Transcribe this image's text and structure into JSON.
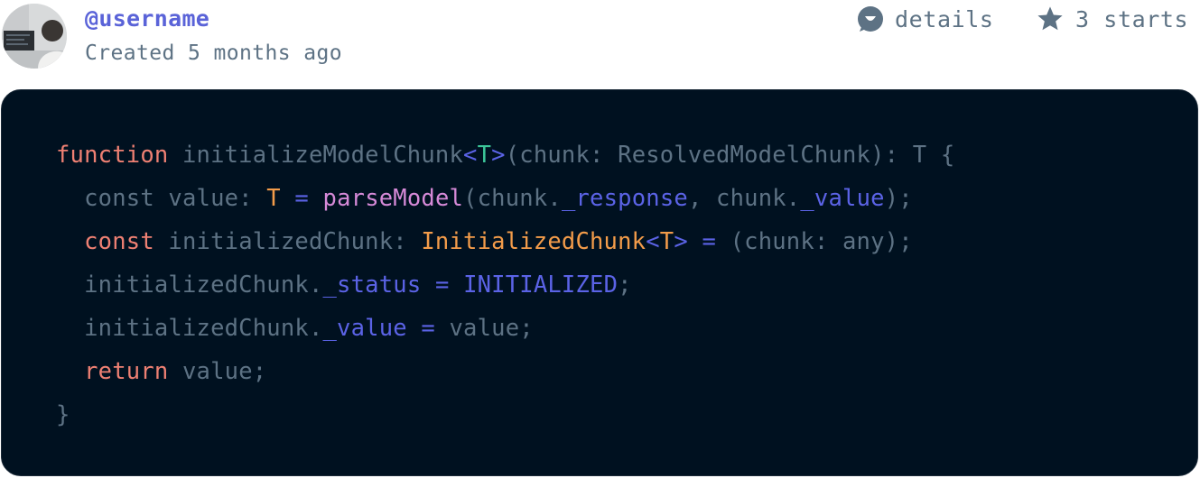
{
  "header": {
    "username": "@username",
    "created": "Created 5 months ago",
    "details_label": "details",
    "stars_label": "3 starts",
    "details_icon": "comment-bubble-icon",
    "stars_icon": "star-icon"
  },
  "colors": {
    "username": "#5a63d8",
    "muted": "#5d7284",
    "code_bg": "#001120",
    "keyword": "#ee8073",
    "type": "#f39c4a",
    "generic": "#3cc69a",
    "function": "#d68ad8",
    "property": "#5b63e6"
  },
  "code": {
    "lines": [
      [
        {
          "t": "function",
          "k": "keyword"
        },
        {
          "t": " initializeModelChunk",
          "k": "plain"
        },
        {
          "t": "<",
          "k": "op"
        },
        {
          "t": "T",
          "k": "generic"
        },
        {
          "t": ">",
          "k": "op"
        },
        {
          "t": "(chunk: ResolvedModelChunk): T {",
          "k": "plain"
        }
      ],
      [
        {
          "t": "  const value: ",
          "k": "plain"
        },
        {
          "t": "T",
          "k": "type"
        },
        {
          "t": " ",
          "k": "plain"
        },
        {
          "t": "=",
          "k": "op"
        },
        {
          "t": " ",
          "k": "plain"
        },
        {
          "t": "parseModel",
          "k": "func"
        },
        {
          "t": "(chunk.",
          "k": "plain"
        },
        {
          "t": "_response",
          "k": "prop"
        },
        {
          "t": ", chunk.",
          "k": "plain"
        },
        {
          "t": "_value",
          "k": "prop"
        },
        {
          "t": ");",
          "k": "plain"
        }
      ],
      [
        {
          "t": "  ",
          "k": "plain"
        },
        {
          "t": "const",
          "k": "keyword"
        },
        {
          "t": " initializedChunk: ",
          "k": "plain"
        },
        {
          "t": "InitializedChunk",
          "k": "type"
        },
        {
          "t": "<",
          "k": "op"
        },
        {
          "t": "T",
          "k": "type"
        },
        {
          "t": ">",
          "k": "op"
        },
        {
          "t": " ",
          "k": "plain"
        },
        {
          "t": "=",
          "k": "op"
        },
        {
          "t": " (chunk: any);",
          "k": "plain"
        }
      ],
      [
        {
          "t": "  initializedChunk.",
          "k": "plain"
        },
        {
          "t": "_status",
          "k": "prop"
        },
        {
          "t": " ",
          "k": "plain"
        },
        {
          "t": "=",
          "k": "op"
        },
        {
          "t": " ",
          "k": "plain"
        },
        {
          "t": "INITIALIZED",
          "k": "prop"
        },
        {
          "t": ";",
          "k": "plain"
        }
      ],
      [
        {
          "t": "  initializedChunk.",
          "k": "plain"
        },
        {
          "t": "_value",
          "k": "prop"
        },
        {
          "t": " ",
          "k": "plain"
        },
        {
          "t": "=",
          "k": "op"
        },
        {
          "t": " value;",
          "k": "plain"
        }
      ],
      [
        {
          "t": "  ",
          "k": "plain"
        },
        {
          "t": "return",
          "k": "keyword"
        },
        {
          "t": " value;",
          "k": "plain"
        }
      ],
      [
        {
          "t": "}",
          "k": "plain"
        }
      ]
    ]
  }
}
